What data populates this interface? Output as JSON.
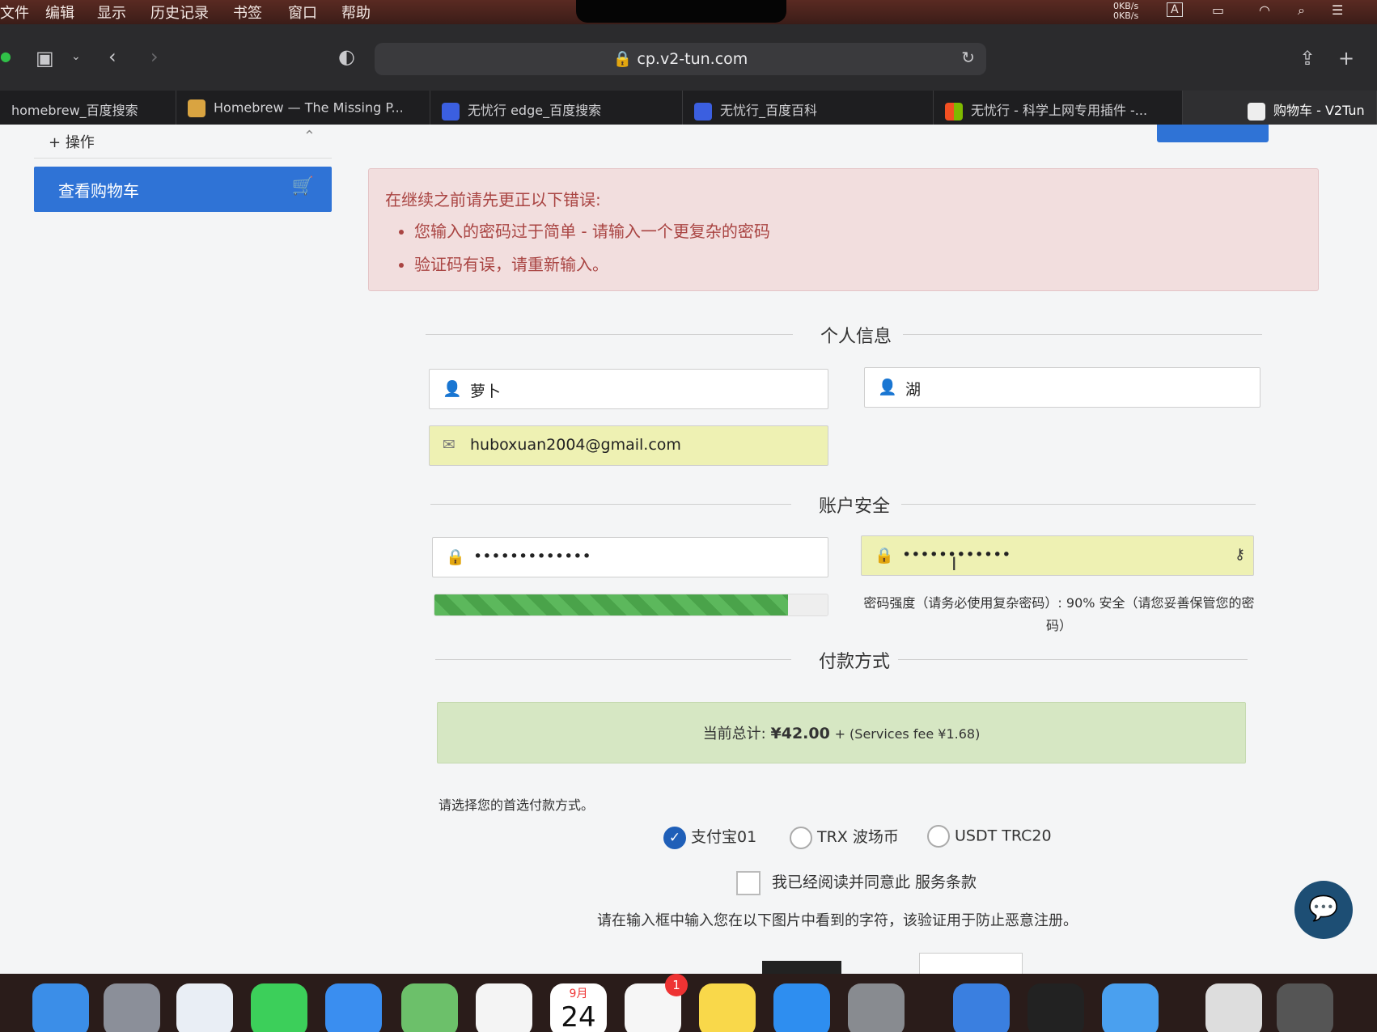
{
  "menubar": {
    "items": [
      "文件",
      "编辑",
      "显示",
      "历史记录",
      "书签",
      "窗口",
      "帮助"
    ],
    "net_up": "0KB/s",
    "net_down": "0KB/s",
    "input_method": "A"
  },
  "toolbar": {
    "url": "cp.v2-tun.com"
  },
  "tabs": [
    {
      "label": "homebrew_百度搜索"
    },
    {
      "label": "Homebrew — The Missing P..."
    },
    {
      "label": "无忧行 edge_百度搜索"
    },
    {
      "label": "无忧行_百度百科"
    },
    {
      "label": "无忧行 - 科学上网专用插件 -..."
    },
    {
      "label": "购物车 - V2Tun"
    }
  ],
  "sidebar": {
    "section_label": "操作",
    "cart_button": "查看购物车"
  },
  "alert": {
    "heading": "在继续之前请先更正以下错误:",
    "errors": [
      "您输入的密码过于简单 - 请输入一个更复杂的密码",
      "验证码有误，请重新输入。"
    ]
  },
  "personal": {
    "title": "个人信息",
    "first_name": "萝卜",
    "last_name": "湖",
    "email": "huboxuan2004@gmail.com"
  },
  "security": {
    "title": "账户安全",
    "password_mask": "•••••••••••••",
    "confirm_mask": "••••••••••••",
    "strength_percent": 90,
    "strength_text": "密码强度（请务必使用复杂密码）: 90% 安全（请您妥善保管您的密码）"
  },
  "payment": {
    "title": "付款方式",
    "total_label": "当前总计:",
    "total_value": "¥42.00",
    "fee": "+ (Services fee ¥1.68)",
    "choose_label": "请选择您的首选付款方式。",
    "options": [
      {
        "label": "支付宝01",
        "selected": true
      },
      {
        "label": "TRX 波场币",
        "selected": false
      },
      {
        "label": "USDT TRC20",
        "selected": false
      }
    ],
    "agree_text": "我已经阅读并同意此 服务条款",
    "captcha_text": "请在输入框中输入您在以下图片中看到的字符，该验证用于防止恶意注册。"
  },
  "dock": {
    "calendar_month": "9月",
    "calendar_day": "24",
    "reminders_badge": "1"
  },
  "colors": {
    "primary": "#2f73d6",
    "alert_bg": "#f2dede",
    "alert_text": "#a94442",
    "autofill": "#eef1b3",
    "success_bg": "#d6e7c3",
    "progress": "#5cb85c"
  }
}
